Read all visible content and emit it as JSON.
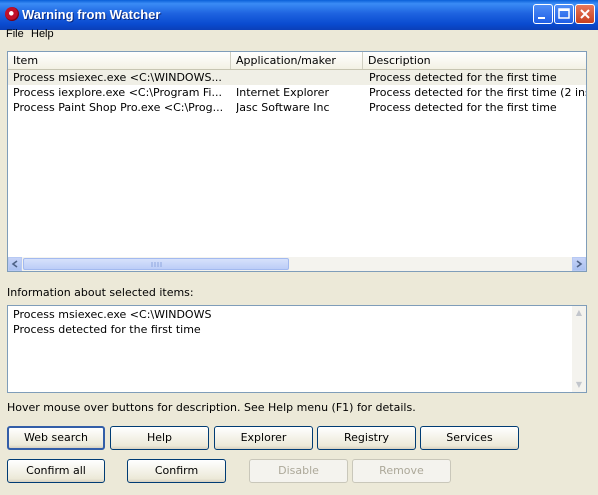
{
  "window": {
    "title": "Warning from Watcher"
  },
  "menu": [
    {
      "label": "File"
    },
    {
      "label": "Help"
    }
  ],
  "list": {
    "columns": [
      {
        "label": "Item"
      },
      {
        "label": "Application/maker"
      },
      {
        "label": "Description"
      }
    ],
    "rows": [
      {
        "item": "Process msiexec.exe <C:\\WINDOWS...",
        "maker": "",
        "description": "Process detected for the first time",
        "selected": true
      },
      {
        "item": "Process iexplore.exe <C:\\Program Fi...",
        "maker": "Internet Explorer",
        "description": "Process detected for the first time (2 ins",
        "selected": false
      },
      {
        "item": "Process Paint Shop Pro.exe <C:\\Prog...",
        "maker": "Jasc Software Inc",
        "description": "Process detected for the first time",
        "selected": false
      }
    ]
  },
  "info": {
    "label": "Information about selected items:",
    "lines": [
      "Process msiexec.exe <C:\\WINDOWS",
      "Process detected for the first time"
    ]
  },
  "hint": "Hover mouse over buttons for description. See Help menu (F1) for details.",
  "buttons_row1": [
    {
      "label": "Web search",
      "default": true
    },
    {
      "label": "Help"
    },
    {
      "label": "Explorer"
    },
    {
      "label": "Registry"
    },
    {
      "label": "Services"
    }
  ],
  "buttons_row2": [
    {
      "label": "Confirm all",
      "enabled": true
    },
    {
      "label": "Confirm",
      "enabled": true
    },
    {
      "label": "Disable",
      "enabled": false
    },
    {
      "label": "Remove",
      "enabled": false
    }
  ]
}
